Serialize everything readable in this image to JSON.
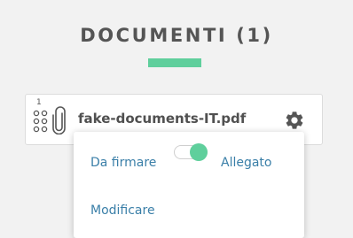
{
  "section": {
    "title": "DOCUMENTI (1)",
    "accent_color": "#5fcf9c"
  },
  "document": {
    "index": "1",
    "filename": "fake-documents-IT.pdf",
    "icons": {
      "drag": "drag-handle-icon",
      "attachment": "paperclip-icon",
      "settings": "gear-icon"
    }
  },
  "menu": {
    "sign_label": "Da firmare",
    "attachment_label": "Allegato",
    "edit_label": "Modificare",
    "toggle": {
      "state": "Allegato",
      "color": "#5fcf9c"
    },
    "link_color": "#3a7fa8"
  }
}
